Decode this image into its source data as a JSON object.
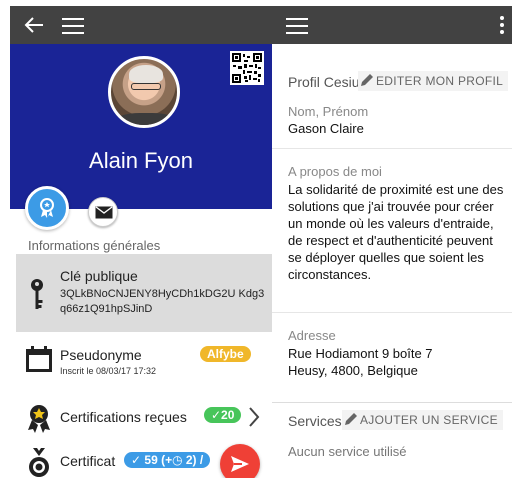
{
  "left": {
    "name": "Alain Fyon",
    "section_title": "Informations générales",
    "pubkey": {
      "label": "Clé publique",
      "value": "3QLkBNoCNJENY8HyCDh1kDG2U Kdg3q66z1Q91hpSJinD"
    },
    "pseudo": {
      "label": "Pseudonyme",
      "sub": "Inscrit le 08/03/17 17:32",
      "badge": "Alfybe"
    },
    "certifications_received": {
      "label": "Certifications reçues",
      "badge": "✓20"
    },
    "certifications_sent": {
      "label": "Certificat",
      "badge": "✓ 59 (+◷ 2) /"
    }
  },
  "right": {
    "profile": {
      "title": "Profil Cesium+",
      "edit_label": "EDITER MON PROFIL"
    },
    "fields": {
      "name_label": "Nom, Prénom",
      "name_value": "Gason Claire",
      "about_label": "A propos de moi",
      "about_value": "La solidarité de proximité est une des solutions que j'ai trouvée pour créer un monde où les valeurs d'entraide, de respect et d'authenticité peuvent se déployer quelles que soient les circonstances.",
      "address_label": "Adresse",
      "address_line1": "Rue Hodiamont 9 boîte 7",
      "address_line2": "Heusy, 4800, Belgique"
    },
    "services": {
      "title": "Services en ligne",
      "add_label": "AJOUTER UN SERVICE",
      "empty_text": "Aucun service utilisé"
    }
  },
  "icons": {
    "back": "back-arrow-icon",
    "menu": "hamburger-menu-icon",
    "more": "more-vert-icon",
    "qr": "qr-code-icon",
    "cert": "certification-icon",
    "mail": "mail-icon",
    "key": "key-icon",
    "calendar": "calendar-icon",
    "medal": "medal-icon",
    "send": "send-icon",
    "edit": "pencil-icon",
    "info": "info-icon"
  },
  "colors": {
    "toolbar": "#424242",
    "hero": "#1a2496",
    "accent_blue": "#3c9be6",
    "badge_orange": "#f0b72a",
    "badge_green": "#47c55a",
    "send_red": "#ef4036"
  }
}
